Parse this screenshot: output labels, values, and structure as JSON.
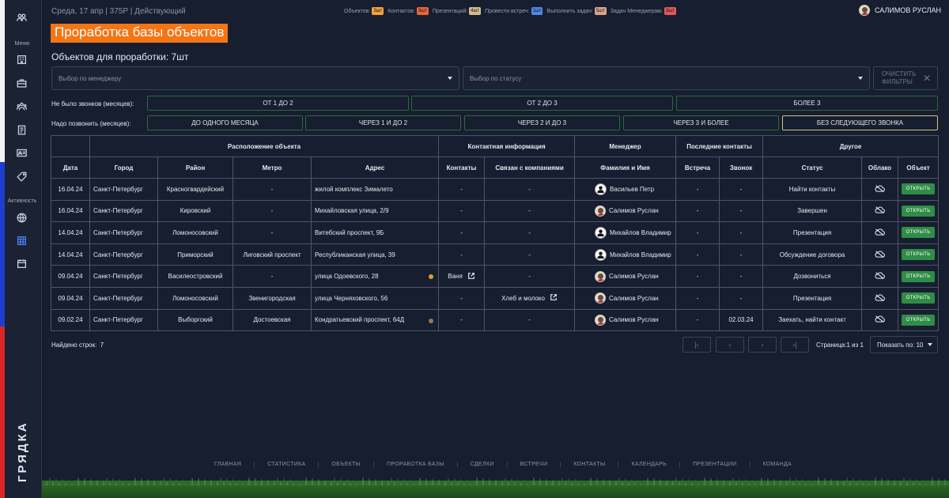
{
  "header": {
    "info": "Среда, 17 апр | 375Р | Действующий",
    "counters": [
      {
        "label": "Объектов:",
        "value": "3шт",
        "color": "#f0a23a"
      },
      {
        "label": "Контактов:",
        "value": "3шт",
        "color": "#e8663a"
      },
      {
        "label": "Презентаций:",
        "value": "4шт",
        "color": "#d6b98a"
      },
      {
        "label": "Провести встреч:",
        "value": "1шт",
        "color": "#4f86e8"
      },
      {
        "label": "Выполнить задач:",
        "value": "5шт",
        "color": "#d9a48a"
      },
      {
        "label": "Задач Менеджерам:",
        "value": "3шт",
        "color": "#e05a5a"
      }
    ],
    "user_name": "САЛИМОВ РУСЛАН"
  },
  "sidebar": {
    "menu_label": "Меню",
    "activity_label": "Активность",
    "brand": "ГРЯДКА"
  },
  "page": {
    "title": "Проработка базы объектов",
    "subtitle": "Объектов для проработки: 7шт"
  },
  "filters": {
    "manager_placeholder": "Выбор по менеджеру",
    "status_placeholder": "Выбор по статусу",
    "clear_label_1": "ОЧИСТИТЬ",
    "clear_label_2": "ФИЛЬТРЫ",
    "no_calls_label": "Не было звонков (месяцев):",
    "no_calls_options": [
      "ОТ 1 ДО 2",
      "ОТ 2 ДО 3",
      "БОЛЕЕ 3"
    ],
    "need_call_label": "Надо позвонить (месяцев):",
    "need_call_options": [
      "ДО ОДНОГО МЕСЯЦА",
      "ЧЕРЕЗ 1 И ДО 2",
      "ЧЕРЕЗ 2 И ДО 3",
      "ЧЕРЕЗ 3 И БОЛЕЕ",
      "БЕЗ СЛЕДУЮЩЕГО ЗВОНКА"
    ],
    "need_call_selected": 4
  },
  "table": {
    "groups": [
      "Расположение объекта",
      "Контактная информация",
      "Менеджер",
      "Последние контакты",
      "Другое"
    ],
    "columns": [
      "Дата",
      "Город",
      "Район",
      "Метро",
      "Адрес",
      "Контакты",
      "Связан с компаниями",
      "Фамилия и Имя",
      "Встреча",
      "Звонок",
      "Статус",
      "Облако",
      "Объект"
    ],
    "open_label": "ОТКРЫТЬ",
    "rows": [
      {
        "date": "16.04.24",
        "city": "Санкт-Петербург",
        "district": "Красногвардейский",
        "metro": "-",
        "address": "жилой комплекс Зималето",
        "dot": "",
        "contacts": "-",
        "contacts_link": false,
        "company": "-",
        "company_link": false,
        "manager": "Васильев Петр",
        "avatar": "blank",
        "meeting": "-",
        "call": "-",
        "status": "Найти контакты"
      },
      {
        "date": "16.04.24",
        "city": "Санкт-Петербург",
        "district": "Кировский",
        "metro": "-",
        "address": "Михайловская улица, 2/9",
        "dot": "",
        "contacts": "-",
        "contacts_link": false,
        "company": "-",
        "company_link": false,
        "manager": "Салимов Руслан",
        "avatar": "photo",
        "meeting": "-",
        "call": "-",
        "status": "Завершен"
      },
      {
        "date": "14.04.24",
        "city": "Санкт-Петербург",
        "district": "Ломоносовский",
        "metro": "-",
        "address": "Витебский проспект, 9Б",
        "dot": "",
        "contacts": "-",
        "contacts_link": false,
        "company": "-",
        "company_link": false,
        "manager": "Михайлов Владимир",
        "avatar": "blank",
        "meeting": "-",
        "call": "-",
        "status": "Презентация"
      },
      {
        "date": "14.04.24",
        "city": "Санкт-Петербург",
        "district": "Приморский",
        "metro": "Лиговский проспект",
        "address": "Республиканская улица, 39",
        "dot": "",
        "contacts": "-",
        "contacts_link": false,
        "company": "-",
        "company_link": false,
        "manager": "Михайлов Владимир",
        "avatar": "blank",
        "meeting": "-",
        "call": "-",
        "status": "Обсуждение договора"
      },
      {
        "date": "09.04.24",
        "city": "Санкт-Петербург",
        "district": "Василеостровский",
        "metro": "-",
        "address": "улица Одоевского, 28",
        "dot": "#e89b2a",
        "contacts": "Ваня",
        "contacts_link": true,
        "company": "-",
        "company_link": false,
        "manager": "Салимов Руслан",
        "avatar": "photo",
        "meeting": "-",
        "call": "-",
        "status": "Дозвониться"
      },
      {
        "date": "09.04.24",
        "city": "Санкт-Петербург",
        "district": "Ломоносовский",
        "metro": "Звенигородская",
        "address": "улица Черняховского, 56",
        "dot": "",
        "contacts": "-",
        "contacts_link": false,
        "company": "Хлеб и молоко",
        "company_link": true,
        "manager": "Салимов Руслан",
        "avatar": "photo",
        "meeting": "-",
        "call": "-",
        "status": "Презентация"
      },
      {
        "date": "09.02.24",
        "city": "Санкт-Петербург",
        "district": "Выборгский",
        "metro": "Достоевская",
        "address": "Кондратьевский проспект, 64Д",
        "dot": "#9a7a4a",
        "contacts": "-",
        "contacts_link": false,
        "company": "-",
        "company_link": false,
        "manager": "Салимов Руслан",
        "avatar": "photo",
        "meeting": "-",
        "call": "02.03.24",
        "status": "Заехать, найти контакт"
      }
    ]
  },
  "footer": {
    "found_label": "Найдено строк:",
    "found_count": "7",
    "page_info": "Страница:1 из 1",
    "per_page": "Показать по: 10",
    "pager": [
      "|‹",
      "‹",
      "›",
      "›|"
    ],
    "nav": [
      "ГЛАВНАЯ",
      "СТАТИСТИКА",
      "ОБЪЕКТЫ",
      "ПРОРАБОТКА БАЗЫ",
      "СДЕЛКИ",
      "ВСТРЕЧИ",
      "КОНТАКТЫ",
      "КАЛЕНДАРЬ",
      "ПРЕЗЕНТАЦИИ",
      "КОМАНДА"
    ]
  }
}
